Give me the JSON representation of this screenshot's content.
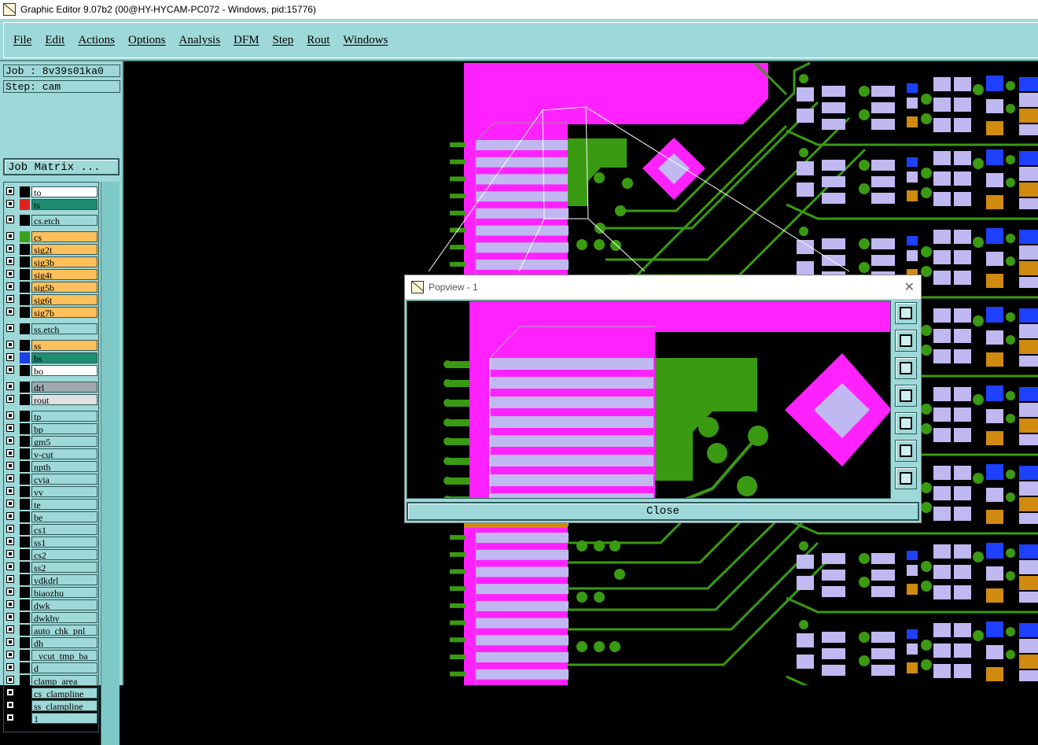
{
  "window": {
    "title": "Graphic Editor 9.07b2 (00@HY-HYCAM-PC072 - Windows, pid:15776)"
  },
  "menu": {
    "items": [
      "File",
      "Edit",
      "Actions",
      "Options",
      "Analysis",
      "DFM",
      "Step",
      "Rout",
      "Windows"
    ]
  },
  "sidebar": {
    "job": "Job : 8v39s01ka0",
    "step": "Step: cam",
    "job_matrix": "Job Matrix ...",
    "layers": [
      {
        "name": "to",
        "color": "#ffffff",
        "swatch": "#000000"
      },
      {
        "name": "ts",
        "color": "#1e8c72",
        "swatch": "#e02020",
        "active": true
      },
      {
        "name": "cs.etch",
        "color": "#9fd8d8",
        "swatch": "#000000"
      },
      {
        "name": "cs",
        "color": "#ffbf5a",
        "swatch": "#3aa01e"
      },
      {
        "name": "sig2t",
        "color": "#ffbf5a",
        "swatch": "#000000"
      },
      {
        "name": "sig3b",
        "color": "#ffbf5a",
        "swatch": "#000000"
      },
      {
        "name": "sig4t",
        "color": "#ffbf5a",
        "swatch": "#000000"
      },
      {
        "name": "sig5b",
        "color": "#ffbf5a",
        "swatch": "#000000"
      },
      {
        "name": "sig6t",
        "color": "#ffbf5a",
        "swatch": "#000000"
      },
      {
        "name": "sig7b",
        "color": "#ffbf5a",
        "swatch": "#000000"
      },
      {
        "name": "ss.etch",
        "color": "#9fd8d8",
        "swatch": "#000000"
      },
      {
        "name": "ss",
        "color": "#ffbf5a",
        "swatch": "#000000"
      },
      {
        "name": "bs",
        "color": "#1e8c72",
        "swatch": "#1f3fe0"
      },
      {
        "name": "bo",
        "color": "#ffffff",
        "swatch": "#000000"
      },
      {
        "name": "drl",
        "color": "#a0a8b0",
        "swatch": "#000000"
      },
      {
        "name": "rout",
        "color": "#e0e0e0",
        "swatch": "#000000"
      },
      {
        "name": "tp",
        "color": "#9fd8d8",
        "swatch": "#000000"
      },
      {
        "name": "bp",
        "color": "#9fd8d8",
        "swatch": "#000000"
      },
      {
        "name": "gm5",
        "color": "#9fd8d8",
        "swatch": "#000000"
      },
      {
        "name": "v-cut",
        "color": "#9fd8d8",
        "swatch": "#000000"
      },
      {
        "name": "npth",
        "color": "#9fd8d8",
        "swatch": "#000000"
      },
      {
        "name": "cvia",
        "color": "#9fd8d8",
        "swatch": "#000000"
      },
      {
        "name": "vv",
        "color": "#9fd8d8",
        "swatch": "#000000"
      },
      {
        "name": "te",
        "color": "#9fd8d8",
        "swatch": "#000000"
      },
      {
        "name": "be",
        "color": "#9fd8d8",
        "swatch": "#000000"
      },
      {
        "name": "cs1",
        "color": "#9fd8d8",
        "swatch": "#000000"
      },
      {
        "name": "ss1",
        "color": "#9fd8d8",
        "swatch": "#000000"
      },
      {
        "name": "cs2",
        "color": "#9fd8d8",
        "swatch": "#000000"
      },
      {
        "name": "ss2",
        "color": "#9fd8d8",
        "swatch": "#000000"
      },
      {
        "name": "ydkdrl",
        "color": "#9fd8d8",
        "swatch": "#000000"
      },
      {
        "name": "biaozhu",
        "color": "#9fd8d8",
        "swatch": "#000000"
      },
      {
        "name": "dwk",
        "color": "#9fd8d8",
        "swatch": "#000000"
      },
      {
        "name": "dwkby",
        "color": "#9fd8d8",
        "swatch": "#000000"
      },
      {
        "name": "auto_chk_pnl",
        "color": "#9fd8d8",
        "swatch": "#000000"
      },
      {
        "name": "dh",
        "color": "#9fd8d8",
        "swatch": "#000000"
      },
      {
        "name": "_vcut_tmp_ba",
        "color": "#9fd8d8",
        "swatch": "#000000"
      },
      {
        "name": "d",
        "color": "#9fd8d8",
        "swatch": "#000000"
      },
      {
        "name": "clamp_area",
        "color": "#9fd8d8",
        "swatch": "#000000"
      },
      {
        "name": "cs_clampline",
        "color": "#9fd8d8",
        "swatch": "#000000"
      },
      {
        "name": "ss_clampline",
        "color": "#9fd8d8",
        "swatch": "#000000"
      },
      {
        "name": "1",
        "color": "#9fd8d8",
        "swatch": "#000000"
      }
    ]
  },
  "popview": {
    "title": "Popview - 1",
    "close_label": "Close"
  },
  "colors": {
    "copper_magenta": "#ff22ff",
    "pad_lavender": "#c0b8f0",
    "trace_green": "#3a9a12",
    "via_blue": "#1e40ff",
    "pad_orange": "#d08a10",
    "ui_teal": "#9fd8d8"
  }
}
